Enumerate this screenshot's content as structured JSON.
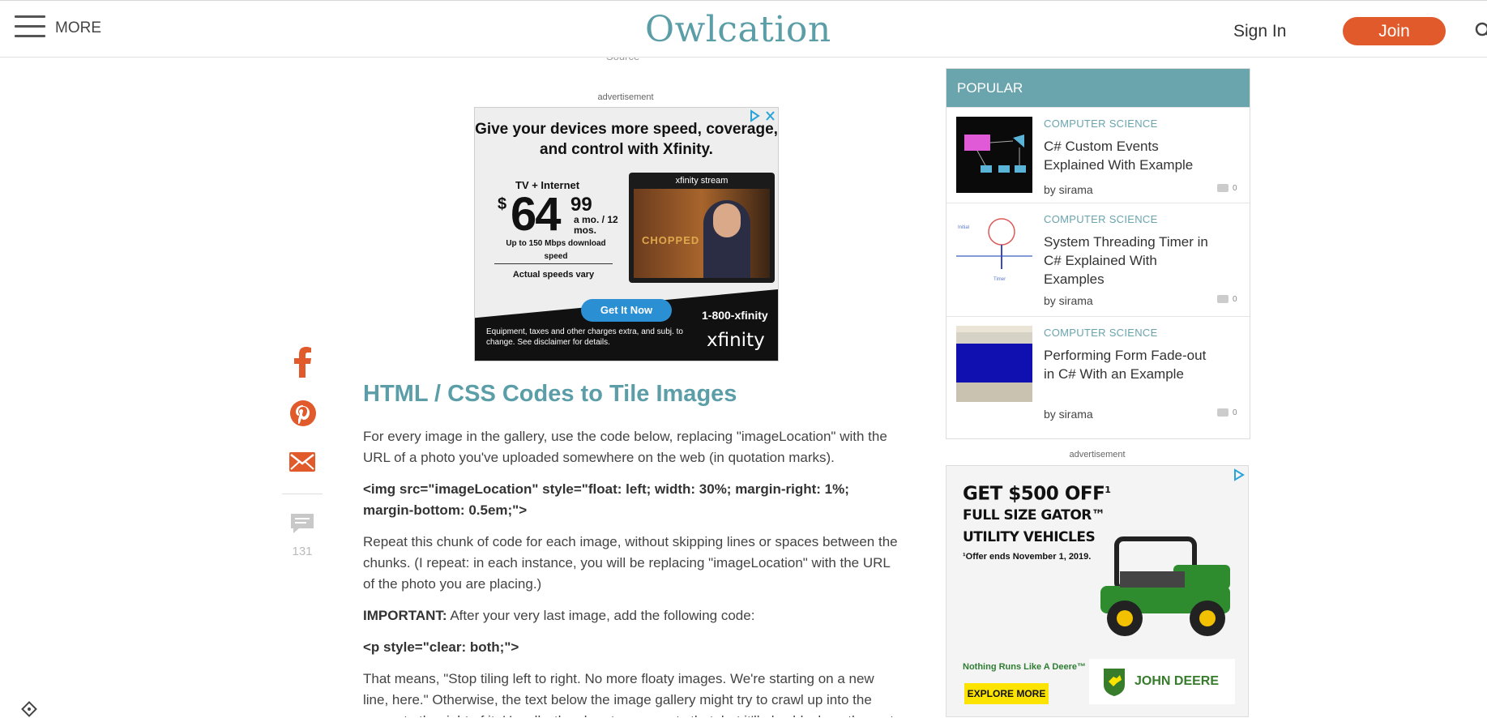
{
  "header": {
    "menu_label": "MORE",
    "logo": "Owlcation",
    "signin_label": "Sign In",
    "join_label": "Join",
    "colors": {
      "brand": "#5b9ea8",
      "join": "#e05a2b"
    }
  },
  "article": {
    "source_caption": "Source",
    "ad_label_top": "advertisement",
    "title": "HTML / CSS Codes to Tile Images",
    "para1": "For every image in the gallery, use the code below, replacing \"imageLocation\" with the URL of a photo you've uploaded somewhere on the web (in quotation marks).",
    "code1": "<img src=\"imageLocation\" style=\"float: left; width: 30%; margin-right: 1%; margin-bottom: 0.5em;\">",
    "para2": "Repeat this chunk of code for each image, without skipping lines or spaces between the chunks. (I repeat: in each instance, you will be replacing \"imageLocation\" with the URL of the photo you are placing.)",
    "important_label": "IMPORTANT:",
    "important_text": " After your very last image, add the following code:",
    "code2": "<p style=\"clear: both;\">",
    "para3": "That means, \"Stop tiling left to right. No more floaty images. We're starting on a new line, here.\" Otherwise, the text below the image gallery might try to crawl up into the space to the right of it. Usually, the clear tag prevents that, but it'll also block up the rest"
  },
  "xfinity_ad": {
    "headline": "Give your devices more speed, coverage, and control with Xfinity.",
    "plan": "TV + Internet",
    "dollar": "$",
    "price": "64",
    "cents": "99",
    "terms": "a mo. / 12 mos.",
    "speed": "Up to 150 Mbps download speed",
    "speeds_vary": "Actual speeds vary",
    "tv_label": "xfinity stream",
    "tv_show": "CHOPPED",
    "cta": "Get It Now",
    "phone": "1-800-xfinity",
    "disclaimer": "Equipment, taxes and other charges extra, and subj. to change. See disclaimer for details.",
    "brand": "xfinity"
  },
  "share": {
    "icons": [
      "facebook-icon",
      "pinterest-icon",
      "email-icon",
      "comment-icon"
    ],
    "color": "#e05a2b",
    "comment_count": "131"
  },
  "sidebar": {
    "popular_title": "POPULAR",
    "items": [
      {
        "category": "COMPUTER SCIENCE",
        "title": "C# Custom Events Explained With Example",
        "author": "by sirama",
        "comments": "0"
      },
      {
        "category": "COMPUTER SCIENCE",
        "title": "System Threading Timer in C# Explained With Examples",
        "author": "by sirama",
        "comments": "0"
      },
      {
        "category": "COMPUTER SCIENCE",
        "title": "Performing Form Fade-out in C# With an Example",
        "author": "by sirama",
        "comments": "0"
      }
    ],
    "ad_label": "advertisement"
  },
  "deere_ad": {
    "headline_prefix": "GET ",
    "headline_amount": "$500 OFF",
    "headline_mark": "1",
    "line2": "FULL SIZE GATOR™",
    "line3": "UTILITY VEHICLES",
    "note": "¹Offer ends November 1, 2019.",
    "tagline": "Nothing Runs Like A Deere™",
    "cta": "EXPLORE MORE",
    "brand": "JOHN DEERE"
  }
}
